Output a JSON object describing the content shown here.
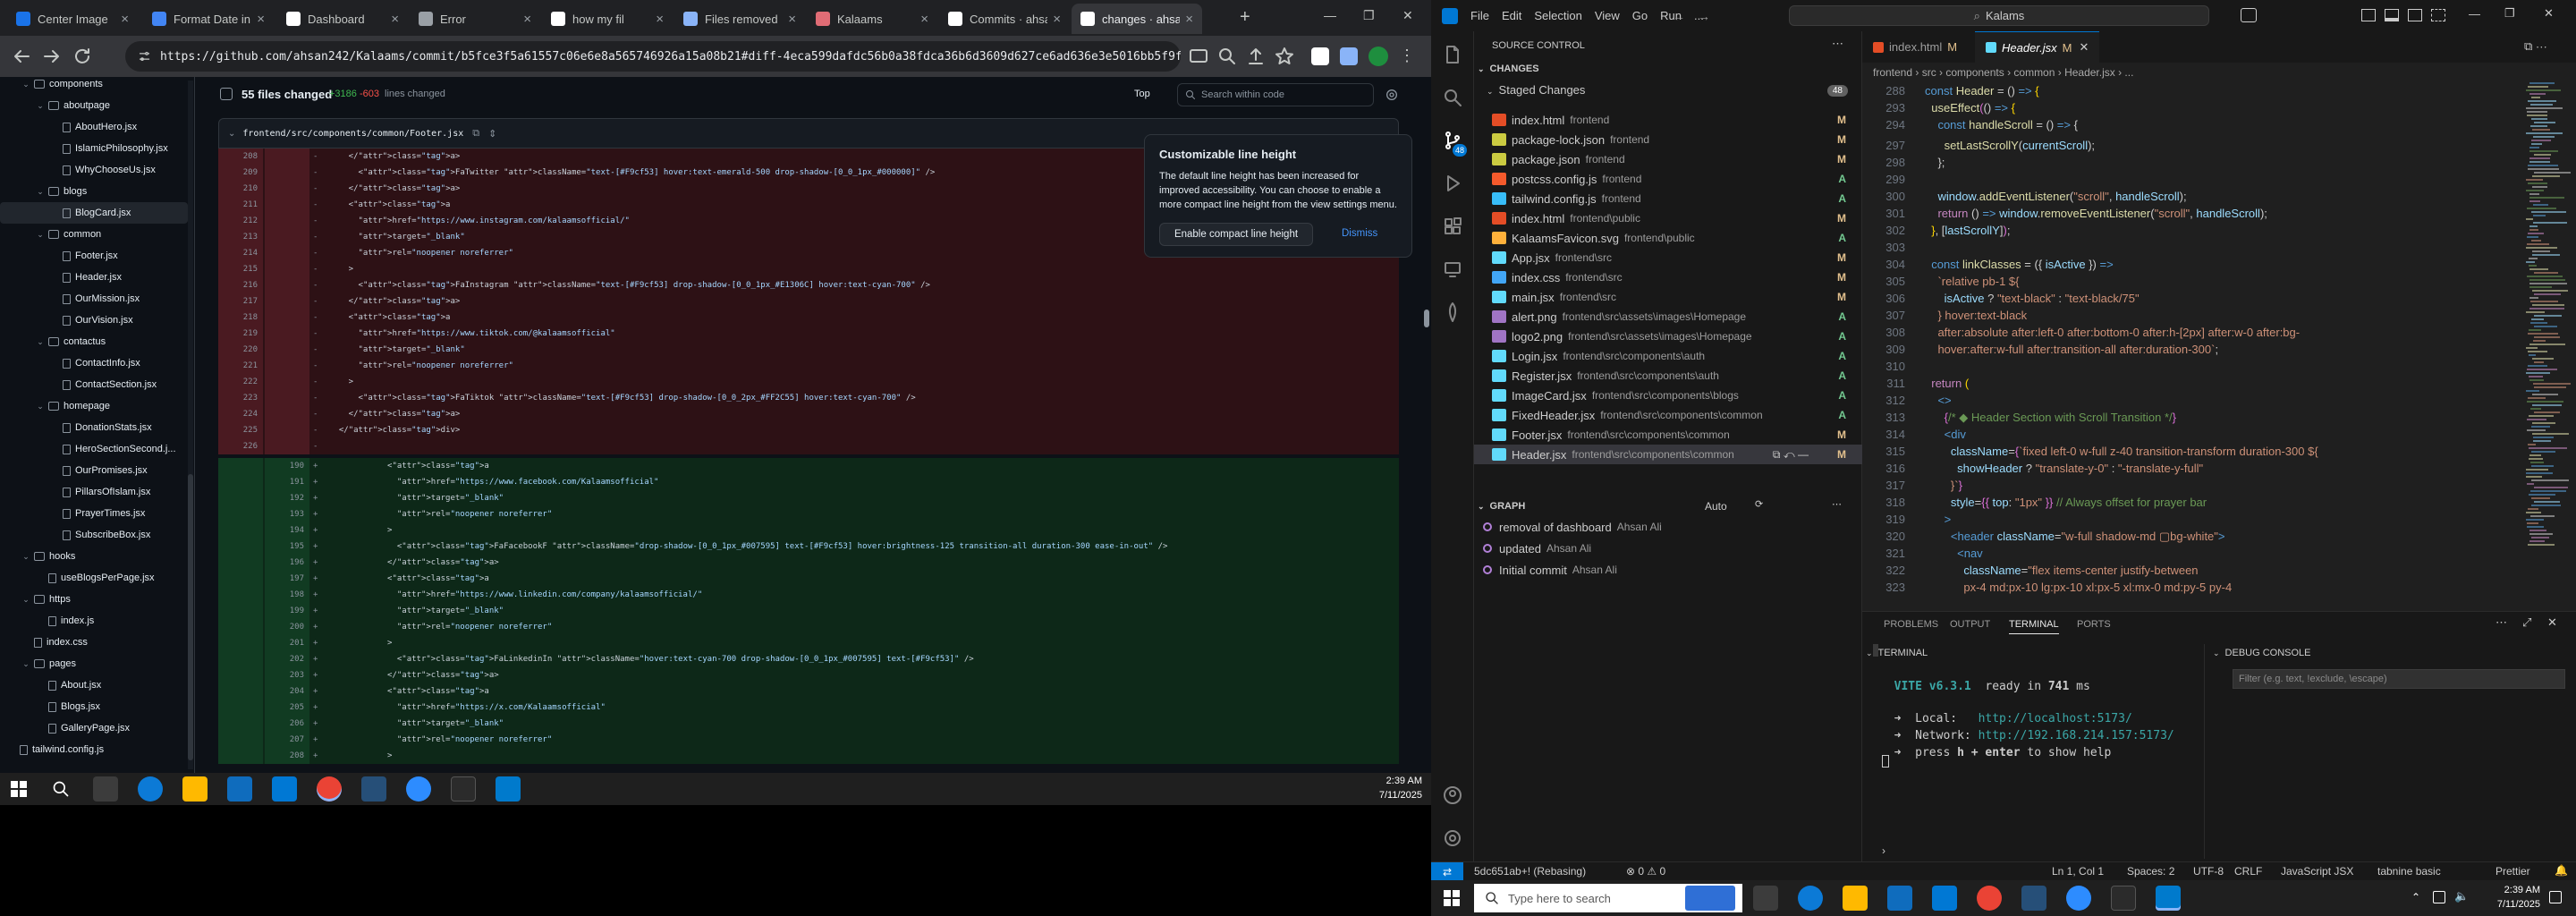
{
  "browser": {
    "tabs": [
      {
        "title": "Center Image",
        "color": "#1a73e8"
      },
      {
        "title": "Format Date in",
        "color": "#4285f4"
      },
      {
        "title": "Dashboard",
        "color": "#ffffff"
      },
      {
        "title": "Error",
        "color": "#9aa0a6"
      },
      {
        "title": "how my fil",
        "color": "#ffffff"
      },
      {
        "title": "Files removed",
        "color": "#8ab4f8"
      },
      {
        "title": "Kalaams",
        "color": "#e06c75"
      },
      {
        "title": "Commits · ahsa",
        "color": "#ffffff"
      },
      {
        "title": "changes · ahsa",
        "color": "#ffffff"
      }
    ],
    "url": "https://github.com/ahsan242/Kalaams/commit/b5fce3f5a61557c06e6e8a565746926a15a08b21#diff-4eca599dafdc56b0a38fdca36b6d3609d627ce6ad636e3e5016bb5f9fee30237c7"
  },
  "filetree": [
    {
      "label": "components",
      "indent": 1,
      "type": "folder",
      "partial": true
    },
    {
      "label": "aboutpage",
      "indent": 2,
      "type": "folder"
    },
    {
      "label": "AboutHero.jsx",
      "indent": 3,
      "type": "file"
    },
    {
      "label": "IslamicPhilosophy.jsx",
      "indent": 3,
      "type": "file"
    },
    {
      "label": "WhyChooseUs.jsx",
      "indent": 3,
      "type": "file"
    },
    {
      "label": "blogs",
      "indent": 2,
      "type": "folder"
    },
    {
      "label": "BlogCard.jsx",
      "indent": 3,
      "type": "file",
      "selected": true
    },
    {
      "label": "common",
      "indent": 2,
      "type": "folder"
    },
    {
      "label": "Footer.jsx",
      "indent": 3,
      "type": "file"
    },
    {
      "label": "Header.jsx",
      "indent": 3,
      "type": "file"
    },
    {
      "label": "OurMission.jsx",
      "indent": 3,
      "type": "file"
    },
    {
      "label": "OurVision.jsx",
      "indent": 3,
      "type": "file"
    },
    {
      "label": "contactus",
      "indent": 2,
      "type": "folder"
    },
    {
      "label": "ContactInfo.jsx",
      "indent": 3,
      "type": "file"
    },
    {
      "label": "ContactSection.jsx",
      "indent": 3,
      "type": "file"
    },
    {
      "label": "homepage",
      "indent": 2,
      "type": "folder"
    },
    {
      "label": "DonationStats.jsx",
      "indent": 3,
      "type": "file"
    },
    {
      "label": "HeroSectionSecond.j...",
      "indent": 3,
      "type": "file"
    },
    {
      "label": "OurPromises.jsx",
      "indent": 3,
      "type": "file"
    },
    {
      "label": "PillarsOfIslam.jsx",
      "indent": 3,
      "type": "file"
    },
    {
      "label": "PrayerTimes.jsx",
      "indent": 3,
      "type": "file"
    },
    {
      "label": "SubscribeBox.jsx",
      "indent": 3,
      "type": "file"
    },
    {
      "label": "hooks",
      "indent": 1,
      "type": "folder"
    },
    {
      "label": "useBlogsPerPage.jsx",
      "indent": 2,
      "type": "file"
    },
    {
      "label": "https",
      "indent": 1,
      "type": "folder"
    },
    {
      "label": "index.js",
      "indent": 2,
      "type": "file"
    },
    {
      "label": "index.css",
      "indent": 1,
      "type": "file"
    },
    {
      "label": "pages",
      "indent": 1,
      "type": "folder"
    },
    {
      "label": "About.jsx",
      "indent": 2,
      "type": "file"
    },
    {
      "label": "Blogs.jsx",
      "indent": 2,
      "type": "file"
    },
    {
      "label": "GalleryPage.jsx",
      "indent": 2,
      "type": "file"
    },
    {
      "label": "tailwind.config.js",
      "indent": 0,
      "type": "file"
    }
  ],
  "diffbar": {
    "files_changed": "55 files changed",
    "additions": "+3186",
    "deletions": "-603",
    "suffix": "lines changed",
    "top": "Top",
    "search_placeholder": "Search within code"
  },
  "diff_file": "frontend/src/components/common/Footer.jsx",
  "diff_lines": [
    {
      "o": "208",
      "s": "-",
      "kind": "del",
      "code": "    </a>"
    },
    {
      "o": "209",
      "s": "-",
      "kind": "del",
      "code": "      <FaTwitter className=\"text-[#F9cf53] hover:text-emerald-500 drop-shadow-[0_0_1px_#000000]\" />"
    },
    {
      "o": "210",
      "s": "-",
      "kind": "del",
      "code": "    </a>"
    },
    {
      "o": "211",
      "s": "-",
      "kind": "del",
      "code": "    <a"
    },
    {
      "o": "212",
      "s": "-",
      "kind": "del",
      "code": "      href=\"https://www.instagram.com/kalaamsofficial/\""
    },
    {
      "o": "213",
      "s": "-",
      "kind": "del",
      "code": "      target=\"_blank\""
    },
    {
      "o": "214",
      "s": "-",
      "kind": "del",
      "code": "      rel=\"noopener noreferrer\""
    },
    {
      "o": "215",
      "s": "-",
      "kind": "del",
      "code": "    >"
    },
    {
      "o": "216",
      "s": "-",
      "kind": "del",
      "code": "      <FaInstagram className=\"text-[#F9cf53] drop-shadow-[0_0_1px_#E1306C] hover:text-cyan-700\" />"
    },
    {
      "o": "217",
      "s": "-",
      "kind": "del",
      "code": "    </a>"
    },
    {
      "o": "218",
      "s": "-",
      "kind": "del",
      "code": "    <a"
    },
    {
      "o": "219",
      "s": "-",
      "kind": "del",
      "code": "      href=\"https://www.tiktok.com/@kalaamsofficial\""
    },
    {
      "o": "220",
      "s": "-",
      "kind": "del",
      "code": "      target=\"_blank\""
    },
    {
      "o": "221",
      "s": "-",
      "kind": "del",
      "code": "      rel=\"noopener noreferrer\""
    },
    {
      "o": "222",
      "s": "-",
      "kind": "del",
      "code": "    >"
    },
    {
      "o": "223",
      "s": "-",
      "kind": "del",
      "code": "      <FaTiktok className=\"text-[#F9cf53] drop-shadow-[0_0_2px_#FF2C55] hover:text-cyan-700\" />"
    },
    {
      "o": "224",
      "s": "-",
      "kind": "del",
      "code": "    </a>"
    },
    {
      "o": "225",
      "s": "-",
      "kind": "del",
      "code": "  </div>"
    },
    {
      "o": "226",
      "s": "-",
      "kind": "del",
      "code": ""
    },
    {
      "n": "190",
      "s": "+",
      "kind": "add",
      "code": "            <a"
    },
    {
      "n": "191",
      "s": "+",
      "kind": "add",
      "code": "              href=\"https://www.facebook.com/Kalaamsofficial\""
    },
    {
      "n": "192",
      "s": "+",
      "kind": "add",
      "code": "              target=\"_blank\""
    },
    {
      "n": "193",
      "s": "+",
      "kind": "add",
      "code": "              rel=\"noopener noreferrer\""
    },
    {
      "n": "194",
      "s": "+",
      "kind": "add",
      "code": "            >"
    },
    {
      "n": "195",
      "s": "+",
      "kind": "add",
      "code": "              <FaFacebookF className=\"drop-shadow-[0_0_1px_#007595] text-[#F9cf53] hover:brightness-125 transition-all duration-300 ease-in-out\" />"
    },
    {
      "n": "196",
      "s": "+",
      "kind": "add",
      "code": "            </a>"
    },
    {
      "n": "197",
      "s": "+",
      "kind": "add",
      "code": "            <a"
    },
    {
      "n": "198",
      "s": "+",
      "kind": "add",
      "code": "              href=\"https://www.linkedin.com/company/kalaamsofficial/\""
    },
    {
      "n": "199",
      "s": "+",
      "kind": "add",
      "code": "              target=\"_blank\""
    },
    {
      "n": "200",
      "s": "+",
      "kind": "add",
      "code": "              rel=\"noopener noreferrer\""
    },
    {
      "n": "201",
      "s": "+",
      "kind": "add",
      "code": "            >"
    },
    {
      "n": "202",
      "s": "+",
      "kind": "add",
      "code": "              <FaLinkedinIn className=\"hover:text-cyan-700 drop-shadow-[0_0_1px_#007595] text-[#F9cf53]\" />"
    },
    {
      "n": "203",
      "s": "+",
      "kind": "add",
      "code": "            </a>"
    },
    {
      "n": "204",
      "s": "+",
      "kind": "add",
      "code": "            <a"
    },
    {
      "n": "205",
      "s": "+",
      "kind": "add",
      "code": "              href=\"https://x.com/Kalaamsofficial\""
    },
    {
      "n": "206",
      "s": "+",
      "kind": "add",
      "code": "              target=\"_blank\""
    },
    {
      "n": "207",
      "s": "+",
      "kind": "add",
      "code": "              rel=\"noopener noreferrer\""
    },
    {
      "n": "208",
      "s": "+",
      "kind": "add",
      "code": "            >"
    }
  ],
  "popup": {
    "title": "Customizable line height",
    "body": "The default line height has been increased for improved accessibility. You can choose to enable a more compact line height from the view settings menu.",
    "button": "Enable compact line height",
    "dismiss": "Dismiss"
  },
  "taskbar_left": {
    "time": "2:39 AM",
    "date": "7/11/2025"
  },
  "vscode": {
    "menu": [
      "File",
      "Edit",
      "Selection",
      "View",
      "Go",
      "Run",
      "..."
    ],
    "search": "Kalams",
    "sidebar_title": "SOURCE CONTROL",
    "changes_label": "CHANGES",
    "staged_label": "Staged Changes",
    "staged_count": "48",
    "staged": [
      {
        "name": "index.html",
        "path": "frontend",
        "st": "M",
        "icon": "#e44d26"
      },
      {
        "name": "package-lock.json",
        "path": "frontend",
        "st": "M",
        "icon": "#cbcb41"
      },
      {
        "name": "package.json",
        "path": "frontend",
        "st": "M",
        "icon": "#cbcb41"
      },
      {
        "name": "postcss.config.js",
        "path": "frontend",
        "st": "A",
        "icon": "#f55a2c"
      },
      {
        "name": "tailwind.config.js",
        "path": "frontend",
        "st": "A",
        "icon": "#38bdf8"
      },
      {
        "name": "index.html",
        "path": "frontend\\public",
        "st": "M",
        "icon": "#e44d26"
      },
      {
        "name": "KalaamsFavicon.svg",
        "path": "frontend\\public",
        "st": "A",
        "icon": "#ffb13b"
      },
      {
        "name": "App.jsx",
        "path": "frontend\\src",
        "st": "M",
        "icon": "#61dafb"
      },
      {
        "name": "index.css",
        "path": "frontend\\src",
        "st": "M",
        "icon": "#42a5f5"
      },
      {
        "name": "main.jsx",
        "path": "frontend\\src",
        "st": "M",
        "icon": "#61dafb"
      },
      {
        "name": "alert.png",
        "path": "frontend\\src\\assets\\images\\Homepage",
        "st": "A",
        "icon": "#a074c4"
      },
      {
        "name": "logo2.png",
        "path": "frontend\\src\\assets\\images\\Homepage",
        "st": "A",
        "icon": "#a074c4"
      },
      {
        "name": "Login.jsx",
        "path": "frontend\\src\\components\\auth",
        "st": "A",
        "icon": "#61dafb"
      },
      {
        "name": "Register.jsx",
        "path": "frontend\\src\\components\\auth",
        "st": "A",
        "icon": "#61dafb"
      },
      {
        "name": "ImageCard.jsx",
        "path": "frontend\\src\\components\\blogs",
        "st": "A",
        "icon": "#61dafb"
      },
      {
        "name": "FixedHeader.jsx",
        "path": "frontend\\src\\components\\common",
        "st": "A",
        "icon": "#61dafb"
      },
      {
        "name": "Footer.jsx",
        "path": "frontend\\src\\components\\common",
        "st": "M",
        "icon": "#61dafb"
      },
      {
        "name": "Header.jsx",
        "path": "frontend\\src\\components\\common",
        "st": "M",
        "icon": "#61dafb",
        "selected": true
      }
    ],
    "graph_label": "GRAPH",
    "graph_auto": "Auto",
    "graph": [
      {
        "msg": "removal of dashboard",
        "author": "Ahsan Ali"
      },
      {
        "msg": "updated",
        "author": "Ahsan Ali"
      },
      {
        "msg": "Initial commit",
        "author": "Ahsan Ali"
      }
    ],
    "editor_tabs": [
      {
        "label": "index.html",
        "st": "M"
      },
      {
        "label": "Header.jsx",
        "st": "M"
      }
    ],
    "breadcrumb": "frontend › src › components › common › Header.jsx › ...",
    "panel_tabs": [
      "PROBLEMS",
      "OUTPUT",
      "TERMINAL",
      "PORTS"
    ],
    "terminal_label": "TERMINAL",
    "debug_label": "DEBUG CONSOLE",
    "debug_filter": "Filter (e.g. text, !exclude, \\escape)",
    "terminal_lines": [
      {
        "a": "VITE v6.3.1",
        "b": "  ready in ",
        "c": "741",
        "d": " ms"
      },
      {
        "a": "➜  Local:   ",
        "b": "http://localhost:5173/"
      },
      {
        "a": "➜  Network: ",
        "b": "http://192.168.214.157:5173/"
      },
      {
        "a": "➜  press ",
        "b": "h + enter",
        "c": " to show help"
      }
    ],
    "status": {
      "branch": "5dc651ab+! (Rebasing)",
      "problems": "⊗ 0 ⚠ 0",
      "pos": "Ln 1, Col 1",
      "spaces": "Spaces: 2",
      "enc": "UTF-8",
      "eol": "CRLF",
      "lang": "JavaScript JSX",
      "tabnine": "tabnine basic",
      "prettier": "Prettier"
    }
  },
  "taskbar_right": {
    "search": "Type here to search",
    "time": "2:39 AM",
    "date": "7/11/2025"
  }
}
